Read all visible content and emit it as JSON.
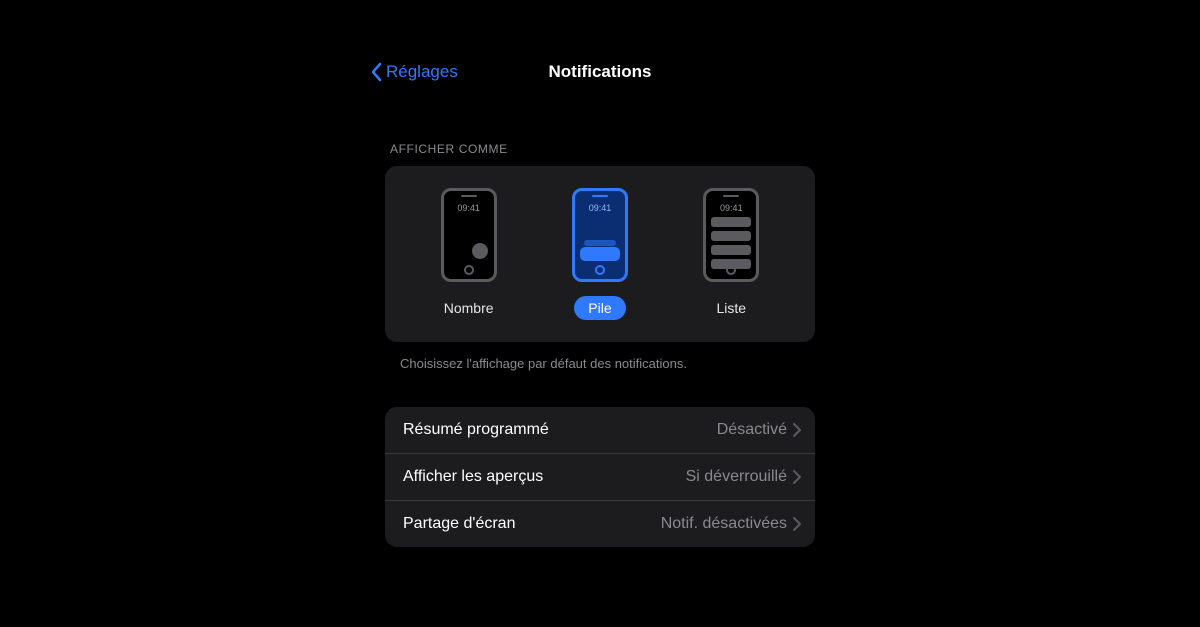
{
  "nav": {
    "back_label": "Réglages",
    "title": "Notifications"
  },
  "display_as": {
    "header": "AFFICHER COMME",
    "clock": "09:41",
    "options": [
      {
        "label": "Nombre"
      },
      {
        "label": "Pile"
      },
      {
        "label": "Liste"
      }
    ],
    "footnote": "Choisissez l'affichage par défaut des notifications."
  },
  "rows": [
    {
      "label": "Résumé programmé",
      "value": "Désactivé"
    },
    {
      "label": "Afficher les aperçus",
      "value": "Si déverrouillé"
    },
    {
      "label": "Partage d'écran",
      "value": "Notif. désactivées"
    }
  ]
}
